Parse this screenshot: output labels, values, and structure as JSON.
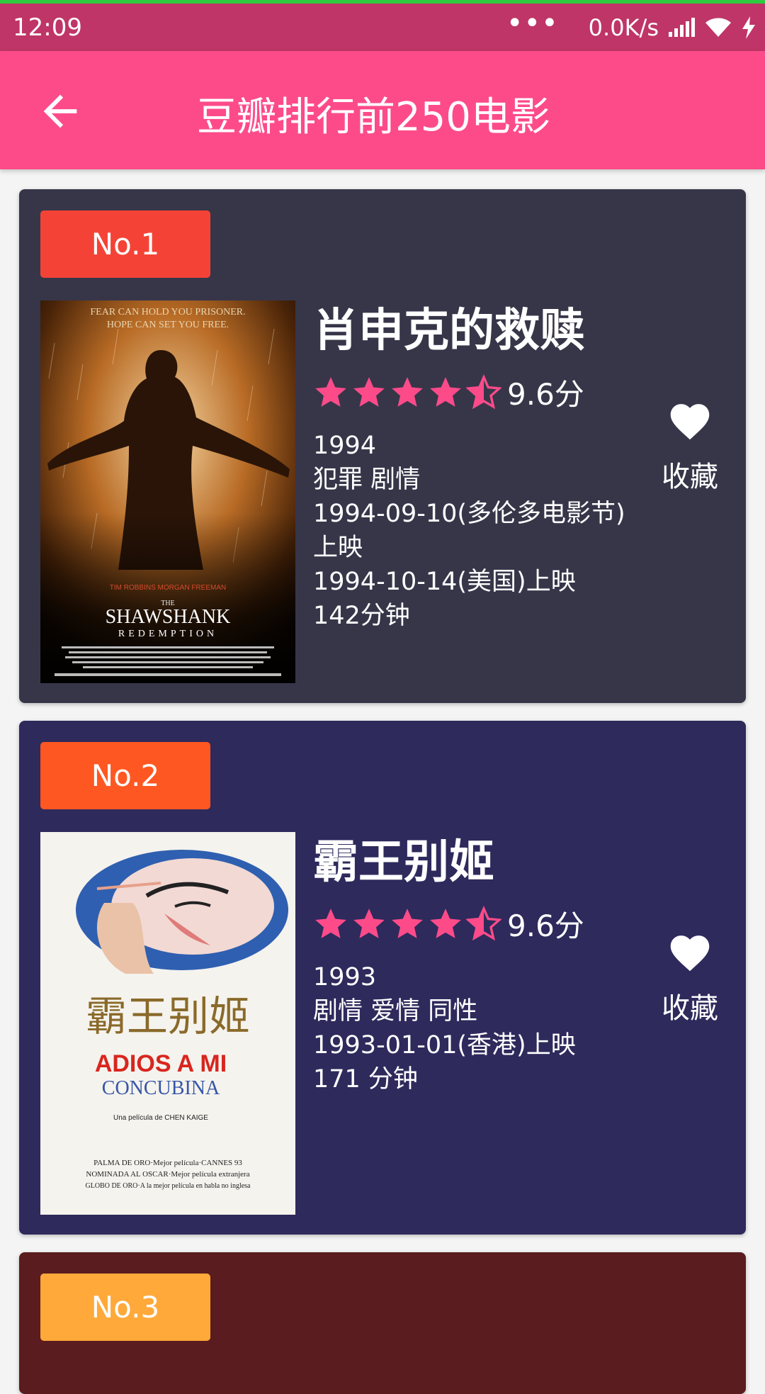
{
  "status_bar": {
    "time": "12:09",
    "dots": "•••",
    "net_speed": "0.0K/s",
    "icons": [
      "signal-icon",
      "wifi-icon",
      "charging-icon"
    ]
  },
  "appbar": {
    "title": "豆瓣排行前250电影",
    "back_icon": "arrow-back-icon",
    "color": "#fd4b8a"
  },
  "movies": [
    {
      "rank": "No.1",
      "rank_color": "#f44336",
      "card_color": "#373649",
      "title": "肖申克的救赎",
      "stars": 4.5,
      "score": "9.6分",
      "year": "1994",
      "genres": "犯罪 剧情",
      "release": "1994-09-10(多伦多电影节)上映",
      "release2": "1994-10-14(美国)上映",
      "duration": "142分钟",
      "poster": {
        "tagline1": "FEAR CAN HOLD YOU PRISONER.",
        "tagline2": "HOPE CAN SET YOU FREE.",
        "cast": "TIM ROBBINS    MORGAN FREEMAN",
        "the": "THE",
        "name": "SHAWSHANK",
        "sub": "REDEMPTION"
      },
      "fav_label": "收藏"
    },
    {
      "rank": "No.2",
      "rank_color": "#ff5722",
      "card_color": "#2e2a5c",
      "title": "霸王别姬",
      "stars": 4.5,
      "score": "9.6分",
      "year": "1993",
      "genres": "剧情 爱情 同性",
      "release": "1993-01-01(香港)上映",
      "duration": "171 分钟",
      "poster": {
        "cn_title": "霸王别姬",
        "name1": "ADIOS A MI",
        "name2": "CONCUBINA",
        "director": "Una película de CHEN KAIGE",
        "award1": "PALMA DE ORO·Mejor película·CANNES 93",
        "award2": "NOMINADA AL OSCAR·Mejor película extranjera",
        "award3": "GLOBO DE ORO·A la mejor película en habla no inglesa"
      },
      "fav_label": "收藏"
    },
    {
      "rank": "No.3",
      "rank_color": "#ffa93a",
      "card_color": "#5a1c1e"
    }
  ]
}
